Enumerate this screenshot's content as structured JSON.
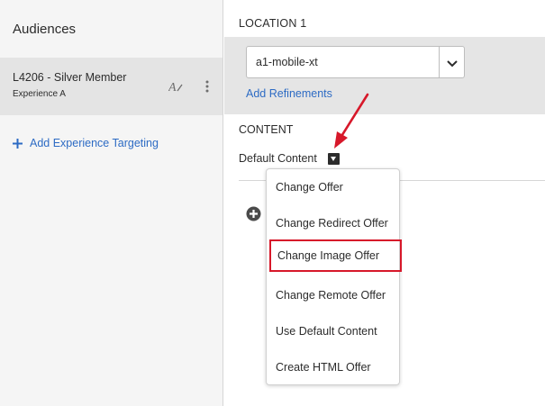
{
  "sidebar": {
    "title": "Audiences",
    "audience": {
      "name": "L4206 - Silver Member",
      "experience": "Experience A"
    },
    "add_targeting_label": "Add Experience Targeting"
  },
  "main": {
    "location_label": "LOCATION 1",
    "location_value": "a1-mobile-xt",
    "add_refinements_label": "Add Refinements",
    "content_label": "CONTENT",
    "default_content_label": "Default Content"
  },
  "menu": {
    "items": [
      "Change Offer",
      "Change Redirect Offer",
      "Change Image Offer",
      "Change Remote Offer",
      "Use Default Content",
      "Create HTML Offer"
    ],
    "highlighted_index": 2
  },
  "colors": {
    "link": "#2d6bc4",
    "annotation": "#d7182a",
    "sidebar_bg": "#f5f5f5",
    "selected_row": "#e4e4e4"
  },
  "icons": {
    "rename": "rename-icon",
    "more": "more-vertical-icon",
    "add": "plus-icon",
    "chevron": "chevron-down-icon",
    "dropdown": "caret-down-icon",
    "add_content": "add-circle-icon",
    "annotation": "red-arrow-icon"
  }
}
